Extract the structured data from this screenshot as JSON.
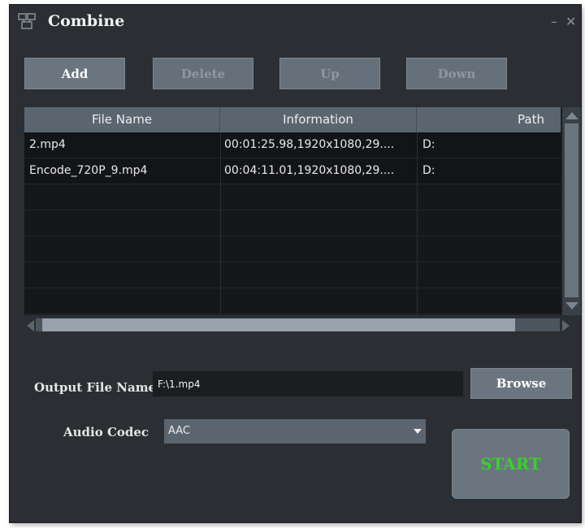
{
  "window": {
    "title": "Combine",
    "minimize_symbol": "–",
    "close_symbol": "✕",
    "app_icon": "combine-app-icon"
  },
  "toolbar": {
    "add_label": "Add",
    "delete_label": "Delete",
    "up_label": "Up",
    "down_label": "Down"
  },
  "table": {
    "headers": {
      "file_name": "File Name",
      "information": "Information",
      "path": "Path"
    },
    "rows": [
      {
        "file_name": "2.mp4",
        "information": "00:01:25.98,1920x1080,29....",
        "path": "D:"
      },
      {
        "file_name": "Encode_720P_9.mp4",
        "information": "00:04:11.01,1920x1080,29....",
        "path": "D:"
      }
    ]
  },
  "output": {
    "label": "Output File Name",
    "value": "F:\\1.mp4",
    "browse_label": "Browse"
  },
  "audio": {
    "label": "Audio Codec",
    "selected": "AAC"
  },
  "start_label": "START",
  "colors": {
    "window_bg": "#2b2f33",
    "button_bg": "#6b7580",
    "start_text": "#39d12a",
    "table_bg": "#15171a"
  }
}
